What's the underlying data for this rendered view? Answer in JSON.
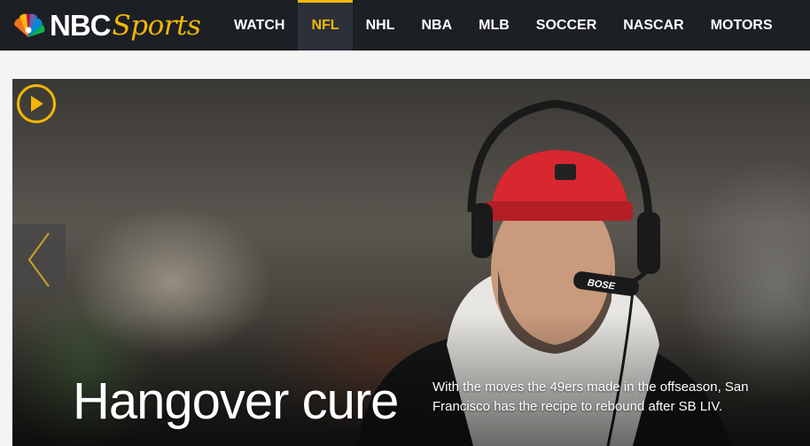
{
  "header": {
    "logo": {
      "brand": "NBC",
      "sub": "Sports",
      "icon": "peacock-icon"
    },
    "nav": [
      {
        "label": "WATCH",
        "active": false
      },
      {
        "label": "NFL",
        "active": true
      },
      {
        "label": "NHL",
        "active": false
      },
      {
        "label": "NBA",
        "active": false
      },
      {
        "label": "MLB",
        "active": false
      },
      {
        "label": "SOCCER",
        "active": false
      },
      {
        "label": "NASCAR",
        "active": false
      },
      {
        "label": "MOTORS",
        "active": false
      }
    ]
  },
  "hero": {
    "headline": "Hangover cure",
    "dek": "With the moves the 49ers made in the offseason, San Francisco has the recipe to rebound after SB LIV.",
    "play_icon": "play-icon",
    "prev_icon": "chevron-left-icon",
    "headset_brand": "BOSE"
  },
  "colors": {
    "accent": "#f2b705",
    "bar": "#1c1f24",
    "active_tab": "#2c3038"
  }
}
